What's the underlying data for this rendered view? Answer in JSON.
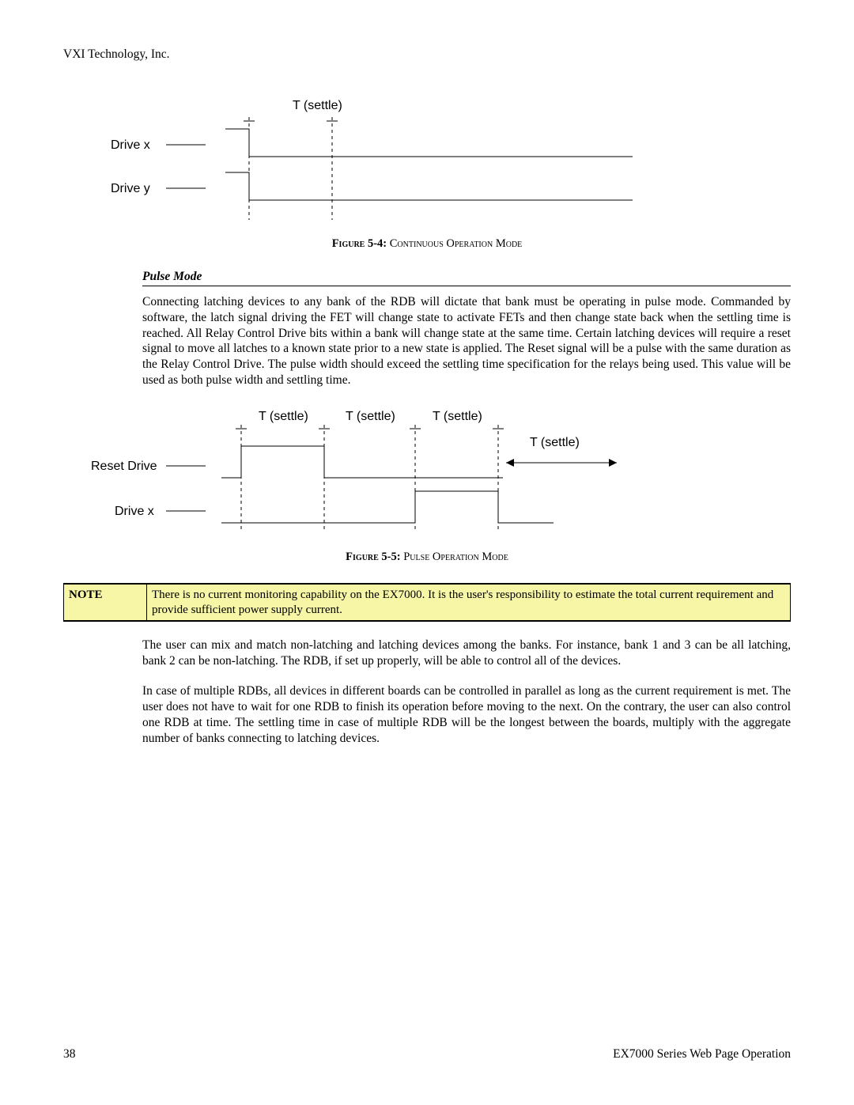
{
  "header": {
    "company": "VXI Technology, Inc."
  },
  "figure54": {
    "caption_prefix": "Figure 5-4: ",
    "caption_title": "Continuous Operation Mode",
    "tsettle": "T (settle)",
    "drive_x": "Drive x",
    "drive_y": "Drive y"
  },
  "pulse_mode": {
    "heading": "Pulse Mode",
    "para": "Connecting latching devices to any bank of the RDB will dictate that bank must be operating in pulse mode. Commanded by software, the latch signal driving the FET will change state to activate FETs and then change state back when the settling time is reached. All Relay Control Drive bits within a bank will change state at the same time. Certain latching devices will require a reset signal to move all latches to a known state prior to a new state is applied. The Reset signal will be a pulse with the same duration as the Relay Control Drive. The pulse width should exceed the settling time specification for the relays being used. This value will be used as both pulse width and settling time."
  },
  "figure55": {
    "caption_prefix": "Figure 5-5: ",
    "caption_title": "Pulse Operation Mode",
    "tsettle": "T (settle)",
    "reset_drive": "Reset Drive",
    "drive_x": "Drive x"
  },
  "note": {
    "label": "NOTE",
    "text": "There is no current monitoring capability on the EX7000. It is the user's responsibility to estimate the total current requirement and provide sufficient power supply current."
  },
  "para_after_note_1": "The user can mix and match non-latching and latching devices among the banks. For instance, bank 1 and 3 can be all latching, bank 2 can be non-latching. The RDB, if set up properly, will be able to control all of the devices.",
  "para_after_note_2": "In case of multiple RDBs, all devices in different boards can be controlled in parallel as long as the current requirement is met. The user does not have to wait for one RDB to finish its operation before moving to the next. On the contrary, the user can also control one RDB at time. The settling time in case of multiple RDB will be the longest between the boards, multiply with the aggregate number of banks connecting to latching devices.",
  "footer": {
    "page_number": "38",
    "section": "EX7000 Series Web Page Operation"
  },
  "chart_data": [
    {
      "type": "timing-diagram",
      "figure": "5-4",
      "title": "Continuous Operation Mode",
      "signals": [
        {
          "name": "Drive x",
          "baseline": "high",
          "events": [
            {
              "t": 0,
              "to": "low"
            }
          ]
        },
        {
          "name": "Drive y",
          "baseline": "high",
          "events": [
            {
              "t": 0,
              "to": "low"
            }
          ]
        }
      ],
      "annotations": [
        {
          "label": "T (settle)",
          "from": "t0",
          "to": "t1",
          "applies_before": "transition"
        }
      ]
    },
    {
      "type": "timing-diagram",
      "figure": "5-5",
      "title": "Pulse Operation Mode",
      "signals": [
        {
          "name": "Reset Drive",
          "baseline": "low",
          "events": [
            {
              "t": 0,
              "to": "high"
            },
            {
              "t": 1,
              "to": "low"
            }
          ]
        },
        {
          "name": "Drive x",
          "baseline": "low",
          "events": [
            {
              "t": 2,
              "to": "high"
            },
            {
              "t": 3,
              "to": "low"
            }
          ]
        }
      ],
      "annotations": [
        {
          "label": "T (settle)",
          "from": "t0",
          "to": "t1"
        },
        {
          "label": "T (settle)",
          "from": "t1",
          "to": "t2"
        },
        {
          "label": "T (settle)",
          "from": "t2",
          "to": "t3"
        },
        {
          "label": "T (settle)",
          "from": "t3",
          "to": "end",
          "arrow": "right"
        }
      ]
    }
  ]
}
